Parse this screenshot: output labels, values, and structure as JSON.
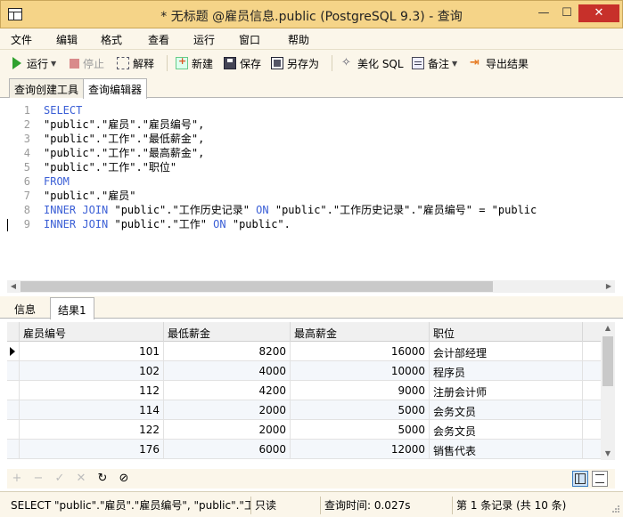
{
  "window": {
    "title": "* 无标题 @雇员信息.public (PostgreSQL 9.3) - 查询",
    "minimize": "—",
    "maximize": "☐",
    "close": "✕"
  },
  "menu": [
    "文件",
    "编辑",
    "格式",
    "查看",
    "运行",
    "窗口",
    "帮助"
  ],
  "toolbar": {
    "run": "运行",
    "stop": "停止",
    "explain": "解释",
    "new": "新建",
    "save": "保存",
    "save_as": "另存为",
    "beautify": "美化 SQL",
    "note": "备注",
    "export": "导出结果"
  },
  "top_tabs": [
    "查询创建工具",
    "查询编辑器"
  ],
  "editor": {
    "lines": [
      {
        "n": "1",
        "code": "SELECT"
      },
      {
        "n": "2",
        "code": "\"public\".\"雇员\".\"雇员编号\","
      },
      {
        "n": "3",
        "code": "\"public\".\"工作\".\"最低薪金\","
      },
      {
        "n": "4",
        "code": "\"public\".\"工作\".\"最高薪金\","
      },
      {
        "n": "5",
        "code": "\"public\".\"工作\".\"职位\""
      },
      {
        "n": "6",
        "code": "FROM"
      },
      {
        "n": "7",
        "code": "\"public\".\"雇员\""
      },
      {
        "n": "8",
        "code": "INNER JOIN \"public\".\"工作历史记录\" ON \"public\".\"工作历史记录\".\"雇员编号\" = \"public"
      },
      {
        "n": "9",
        "code": "INNER JOIN \"public\".\"工作\" ON \"public\"."
      }
    ]
  },
  "result_tabs": [
    "信息",
    "结果1"
  ],
  "grid": {
    "columns": [
      "雇员编号",
      "最低薪金",
      "最高薪金",
      "职位"
    ],
    "rows": [
      [
        "101",
        "8200",
        "16000",
        "会计部经理"
      ],
      [
        "102",
        "4000",
        "10000",
        "程序员"
      ],
      [
        "112",
        "4200",
        "9000",
        "注册会计师"
      ],
      [
        "114",
        "2000",
        "5000",
        "会务文员"
      ],
      [
        "122",
        "2000",
        "5000",
        "会务文员"
      ],
      [
        "176",
        "6000",
        "12000",
        "销售代表"
      ]
    ]
  },
  "nav_buttons": [
    "+",
    "−",
    "✓",
    "✕",
    "↻",
    "⊘"
  ],
  "status": {
    "sql": "SELECT \"public\".\"雇员\".\"雇员编号\", \"public\".\"工作",
    "readonly": "只读",
    "query_time": "查询时间: 0.027s",
    "record": "第 1 条记录 (共 10 条)"
  },
  "colors": {
    "titlebar": "#f5d488",
    "close_button": "#c7302a",
    "keyword": "#3b5fd6",
    "chrome": "#fbf6ea"
  }
}
